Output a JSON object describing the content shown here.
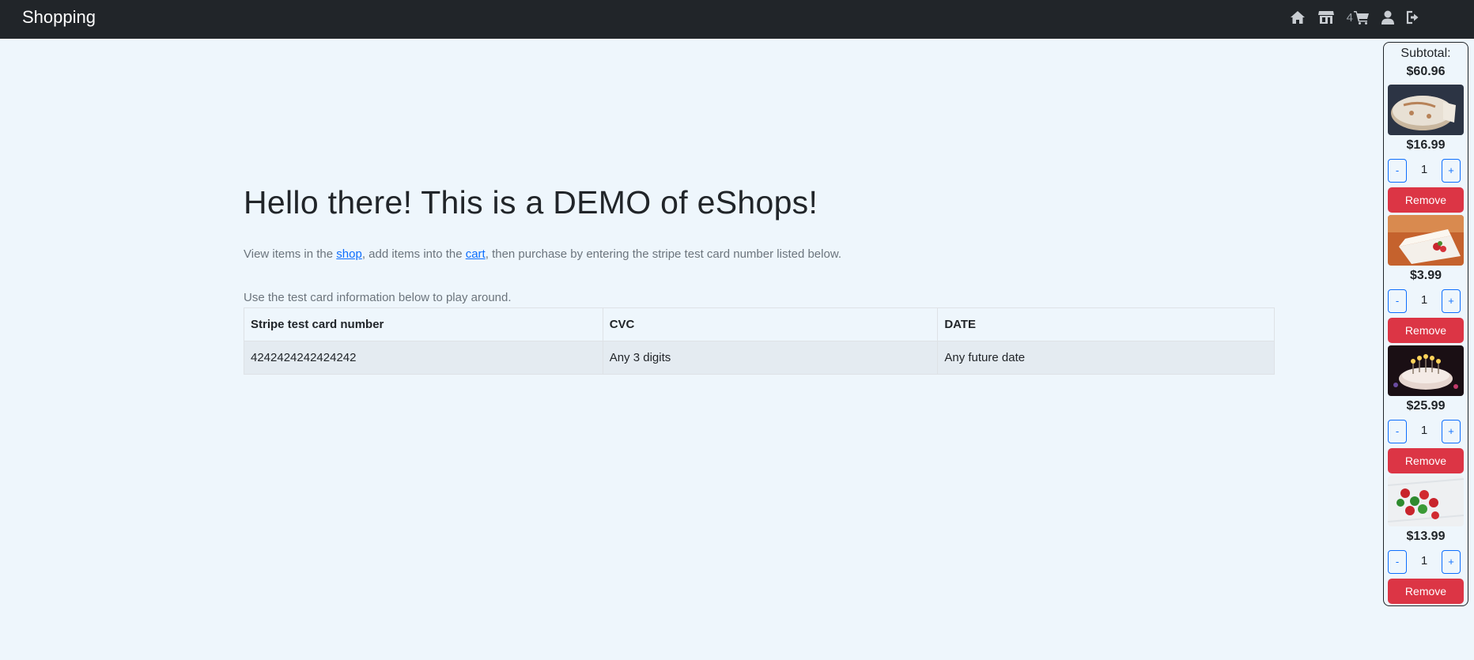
{
  "nav": {
    "brand": "Shopping",
    "cart_count": "4",
    "icons": [
      "home-icon",
      "store-icon",
      "cart-icon",
      "user-icon",
      "logout-icon"
    ]
  },
  "main": {
    "heading": "Hello there! This is a DEMO of eShops!",
    "intro": {
      "part1": "View items in the ",
      "shop_link": "shop",
      "part2": ", add items into the ",
      "cart_link": "cart",
      "part3": ", then purchase by entering the stripe test card number listed below."
    },
    "card_hint": "Use the test card information below to play around.",
    "table": {
      "headers": [
        "Stripe test card number",
        "CVC",
        "DATE"
      ],
      "rows": [
        [
          "4242424242424242",
          "Any 3 digits",
          "Any future date"
        ]
      ]
    }
  },
  "cart": {
    "subtotal_label": "Subtotal:",
    "subtotal_value": "$60.96",
    "minus_label": "-",
    "plus_label": "+",
    "remove_label": "Remove",
    "items": [
      {
        "price": "$16.99",
        "qty": "1",
        "image": "cake-icon"
      },
      {
        "price": "$3.99",
        "qty": "1",
        "image": "cheesecake-slice-icon"
      },
      {
        "price": "$25.99",
        "qty": "1",
        "image": "birthday-cake-candles-icon"
      },
      {
        "price": "$13.99",
        "qty": "1",
        "image": "candy-icon"
      }
    ]
  },
  "colors": {
    "navbar": "#212529",
    "background": "#eef6fc",
    "link": "#0d6efd",
    "remove": "#dc3545"
  }
}
